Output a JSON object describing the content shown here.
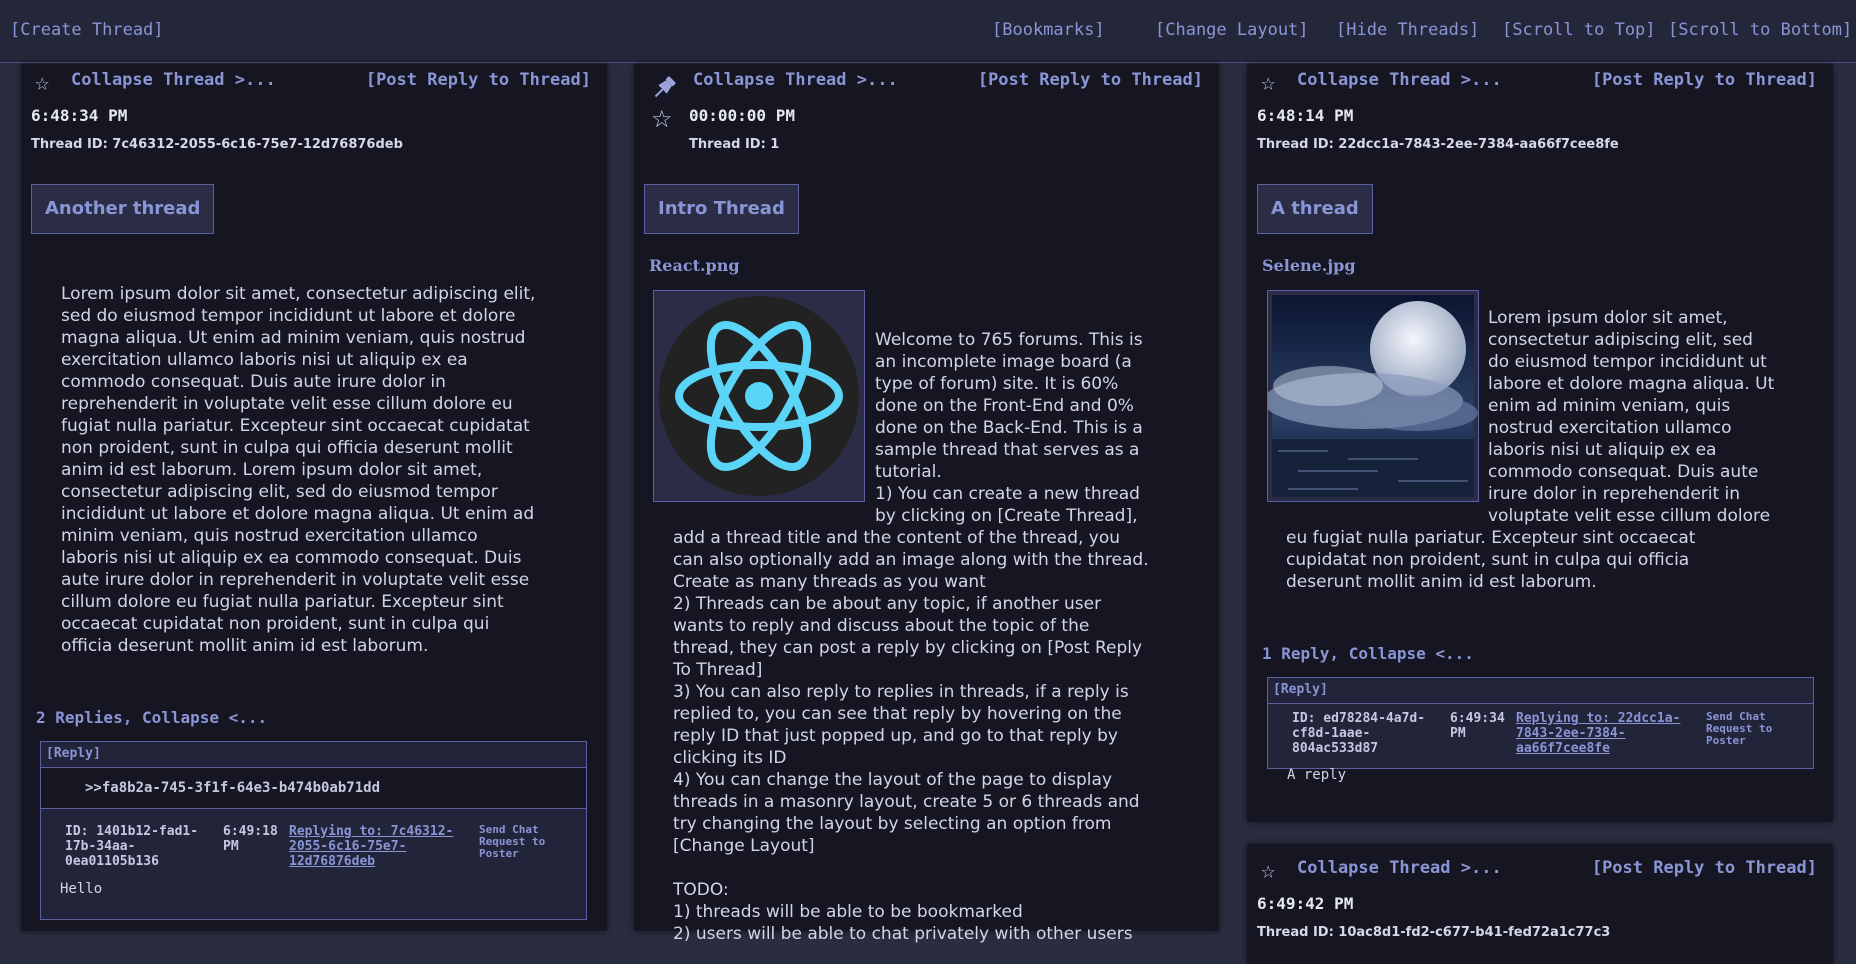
{
  "topbar": {
    "create_thread": "[Create Thread]",
    "bookmarks": "[Bookmarks]",
    "change_layout": "[Change Layout]",
    "hide_threads": "[Hide Threads]",
    "scroll_top": "[Scroll to Top]",
    "scroll_bottom": "[Scroll to Bottom]"
  },
  "threads": [
    {
      "collapse": "Collapse Thread >...",
      "post_reply": "[Post Reply to Thread]",
      "time": "6:48:34 PM",
      "thread_id": "Thread ID: 7c46312-2055-6c16-75e7-12d76876deb",
      "title": "Another thread",
      "body": "Lorem ipsum dolor sit amet, consectetur adipiscing elit,\nsed do eiusmod tempor incididunt ut labore et dolore\nmagna aliqua. Ut enim ad minim veniam, quis nostrud\nexercitation ullamco laboris nisi ut aliquip ex ea\ncommodo consequat. Duis aute irure dolor in\nreprehenderit in voluptate velit esse cillum dolore eu\nfugiat nulla pariatur. Excepteur sint occaecat cupidatat\nnon proident, sunt in culpa qui officia deserunt mollit\nanim id est laborum. Lorem ipsum dolor sit amet,\nconsectetur adipiscing elit, sed do eiusmod tempor\nincididunt ut labore et dolore magna aliqua. Ut enim ad\nminim veniam, quis nostrud exercitation ullamco\nlaboris nisi ut aliquip ex ea commodo consequat. Duis\naute irure dolor in reprehenderit in voluptate velit esse\ncillum dolore eu fugiat nulla pariatur. Excepteur sint\noccaecat cupidatat non proident, sunt in culpa qui\nofficia deserunt mollit anim id est laborum.",
      "replies_header": "2 Replies, Collapse <...",
      "reply": {
        "tag": "[Reply]",
        "quote": ">>fa8b2a-745-3f1f-64e3-b474b0ab71dd",
        "id": "ID: 1401b12-fad1-\n17b-34aa-\n0ea01105b136",
        "time": "6:49:18\nPM",
        "replying": "Replying to: 7c46312-\n2055-6c16-75e7-\n12d76876deb",
        "chat": "Send Chat\nRequest to\nPoster",
        "text": "Hello"
      }
    },
    {
      "collapse": "Collapse Thread >...",
      "post_reply": "[Post Reply to Thread]",
      "time": "00:00:00 PM",
      "thread_id": "Thread ID: 1",
      "title": "Intro Thread",
      "image_name": "React.png",
      "body_side": "Welcome to 765 forums. This is\nan incomplete image board (a\ntype of forum) site. It is 60%\ndone on the Front-End and 0%\ndone on the Back-End. This is a\nsample thread that serves as a\ntutorial.\n1) You can create a new thread\nby clicking on [Create Thread],",
      "body_full": "add a thread title and the content of the thread, you\ncan also optionally add an image along with the thread.\nCreate as many threads as you want\n2) Threads can be about any topic, if another user\nwants to reply and discuss about the topic of the\nthread, they can post a reply by clicking on [Post Reply\nTo Thread]\n3) You can also reply to replies in threads, if a reply is\nreplied to, you can see that reply by hovering on the\nreply ID that just popped up, and go to that reply by\nclicking its ID\n4) You can change the layout of the page to display\nthreads in a masonry layout, create 5 or 6 threads and\ntry changing the layout by selecting an option from\n[Change Layout]\n\nTODO:\n1) threads will be able to be bookmarked\n2) users will be able to chat privately with other users"
    },
    {
      "collapse": "Collapse Thread >...",
      "post_reply": "[Post Reply to Thread]",
      "time": "6:48:14 PM",
      "thread_id": "Thread ID: 22dcc1a-7843-2ee-7384-aa66f7cee8fe",
      "title": "A thread",
      "image_name": "Selene.jpg",
      "body_side": "Lorem ipsum dolor sit amet,\nconsectetur adipiscing elit, sed\ndo eiusmod tempor incididunt ut\nlabore et dolore magna aliqua. Ut\nenim ad minim veniam, quis\nnostrud exercitation ullamco\nlaboris nisi ut aliquip ex ea\ncommodo consequat. Duis aute\nirure dolor in reprehenderit in\nvoluptate velit esse cillum dolore",
      "body_full": "eu fugiat nulla pariatur. Excepteur sint occaecat\ncupidatat non proident, sunt in culpa qui officia\ndeserunt mollit anim id est laborum.",
      "replies_header": "1 Reply, Collapse <...",
      "reply": {
        "tag": "[Reply]",
        "id": "ID: ed78284-4a7d-\ncf8d-1aae-\n804ac533d87",
        "time": "6:49:34\nPM",
        "replying": "Replying to: 22dcc1a-\n7843-2ee-7384-\naa66f7cee8fe",
        "chat": "Send Chat\nRequest to\nPoster",
        "text": "A reply"
      }
    },
    {
      "collapse": "Collapse Thread >...",
      "post_reply": "[Post Reply to Thread]",
      "time": "6:49:42 PM",
      "thread_id": "Thread ID: 10ac8d1-fd2-c677-b41-fed72a1c77c3"
    }
  ]
}
